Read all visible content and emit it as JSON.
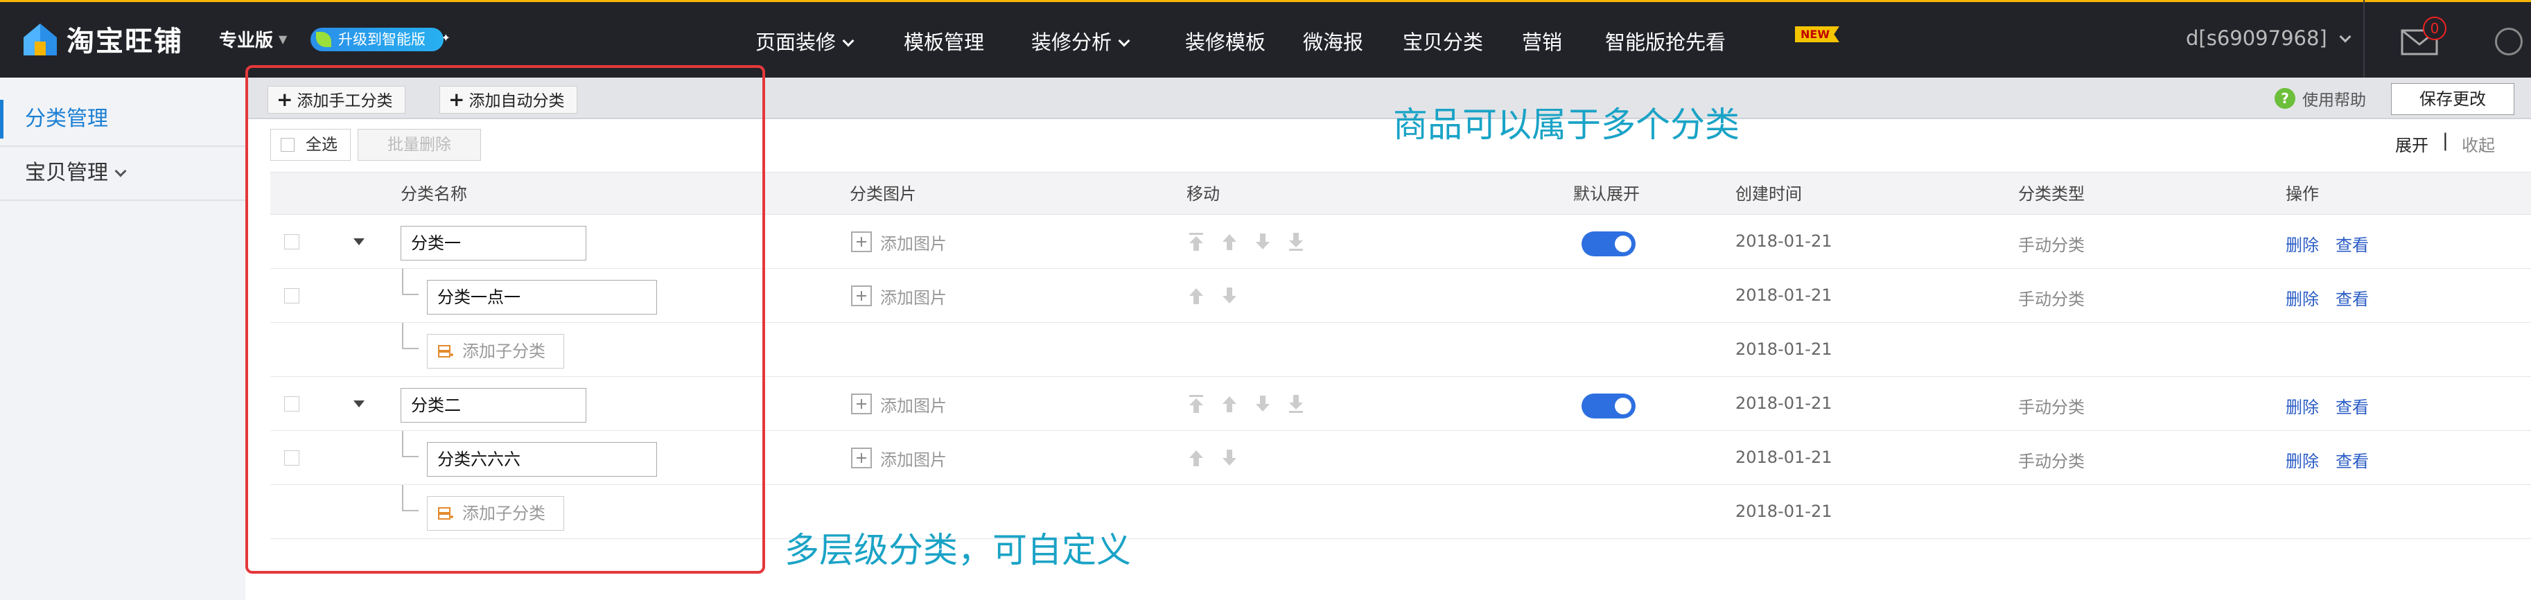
{
  "app": {
    "brand_name": "淘宝旺铺",
    "edition": "专业版",
    "upgrade_label": "升级到智能版"
  },
  "nav": {
    "items": [
      {
        "label": "页面装修",
        "dropdown": true
      },
      {
        "label": "模板管理",
        "dropdown": false
      },
      {
        "label": "装修分析",
        "dropdown": true
      },
      {
        "label": "装修模板",
        "dropdown": false
      },
      {
        "label": "微海报",
        "dropdown": false
      },
      {
        "label": "宝贝分类",
        "dropdown": false
      },
      {
        "label": "营销",
        "dropdown": false
      },
      {
        "label": "智能版抢先看",
        "dropdown": false
      }
    ],
    "new_badge": "NEW",
    "account": "d[s69097968]",
    "mail_count": "0"
  },
  "sidebar": {
    "items": [
      {
        "label": "分类管理",
        "active": true
      },
      {
        "label": "宝贝管理",
        "active": false
      }
    ]
  },
  "toolbar": {
    "add_manual": "添加手工分类",
    "add_auto": "添加自动分类",
    "help": "使用帮助",
    "save": "保存更改"
  },
  "subtoolbar": {
    "select_all": "全选",
    "batch_delete": "批量删除",
    "expand": "展开",
    "separator": "|",
    "collapse": "收起"
  },
  "table": {
    "headers": [
      "分类名称",
      "分类图片",
      "移动",
      "默认展开",
      "创建时间",
      "分类类型",
      "操作"
    ],
    "rows": [
      {
        "kind": "parent",
        "name": "分类一",
        "image": "添加图片",
        "default_expand": true,
        "date": "2018-01-21",
        "type": "手动分类",
        "delete": "删除",
        "view": "查看"
      },
      {
        "kind": "child",
        "name": "分类一点一",
        "image": "添加图片",
        "date": "2018-01-21",
        "type": "手动分类",
        "delete": "删除",
        "view": "查看"
      },
      {
        "kind": "add",
        "add_label": "添加子分类",
        "date": "2018-01-21"
      },
      {
        "kind": "parent",
        "name": "分类二",
        "image": "添加图片",
        "default_expand": true,
        "date": "2018-01-21",
        "type": "手动分类",
        "delete": "删除",
        "view": "查看"
      },
      {
        "kind": "child",
        "name": "分类六六六",
        "image": "添加图片",
        "date": "2018-01-21",
        "type": "手动分类",
        "delete": "删除",
        "view": "查看"
      },
      {
        "kind": "add",
        "add_label": "添加子分类",
        "date": "2018-01-21"
      }
    ]
  },
  "annotations": {
    "top": "商品可以属于多个分类",
    "bottom": "多层级分类，可自定义"
  },
  "colors": {
    "topbar": "#222329",
    "accent_blue": "#1a7fd4",
    "toggle_on": "#2d6fe0",
    "link": "#2a5cc5",
    "annotation": "#1aa3c6",
    "frame": "#e5383b"
  }
}
